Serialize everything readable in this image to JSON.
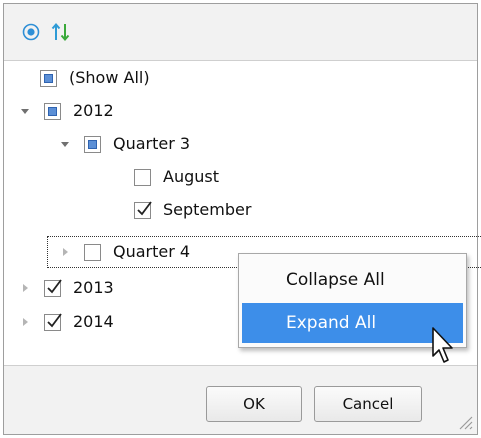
{
  "toolbar": {
    "radio_icon": "radio-target-icon",
    "sort_icon": "sort-arrows-icon",
    "sort_colors": [
      "#2e9bd6",
      "#3aa93a"
    ]
  },
  "tree": {
    "show_all": "(Show All)",
    "year_2012": "2012",
    "quarter_3": "Quarter 3",
    "august": "August",
    "september": "September",
    "quarter_4": "Quarter 4",
    "year_2013": "2013",
    "year_2014": "2014"
  },
  "context_menu": {
    "collapse_all": "Collapse All",
    "expand_all": "Expand All",
    "highlight_color": "#3d8ee9"
  },
  "footer": {
    "ok_label": "OK",
    "cancel_label": "Cancel"
  }
}
